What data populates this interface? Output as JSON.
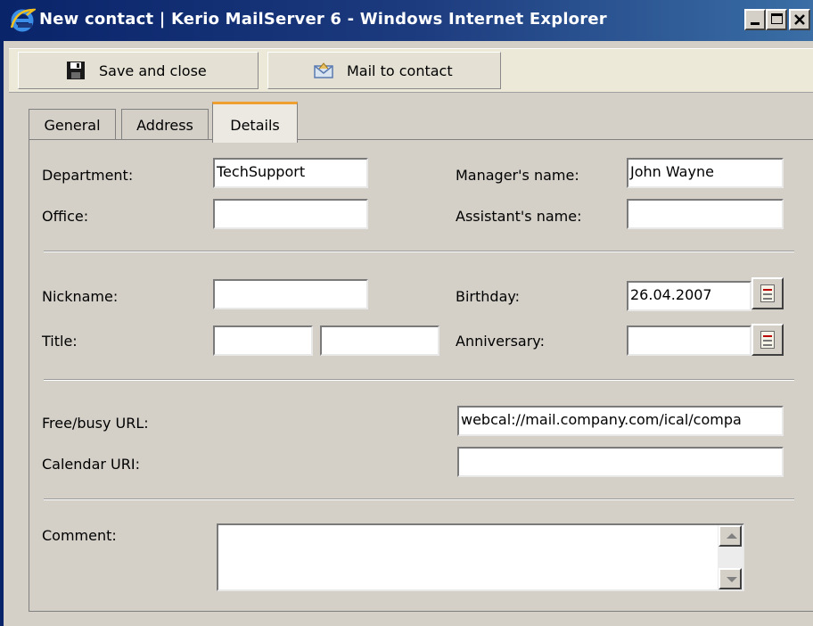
{
  "window": {
    "title": "New contact | Kerio MailServer 6 - Windows Internet Explorer",
    "icon": "internet-explorer-icon"
  },
  "toolbar": {
    "save_label": "Save and close",
    "save_icon": "floppy-disk-icon",
    "mail_label": "Mail to contact",
    "mail_icon": "envelope-icon"
  },
  "tabs": [
    {
      "label": "General"
    },
    {
      "label": "Address"
    },
    {
      "label": "Details",
      "active": true
    }
  ],
  "form": {
    "department_label": "Department:",
    "department_value": "TechSupport",
    "manager_label": "Manager's name:",
    "manager_value": "John Wayne",
    "office_label": "Office:",
    "office_value": "",
    "assistant_label": "Assistant's name:",
    "assistant_value": "",
    "nickname_label": "Nickname:",
    "nickname_value": "",
    "birthday_label": "Birthday:",
    "birthday_value": "26.04.2007",
    "title_label": "Title:",
    "title_value_1": "",
    "title_value_2": "",
    "anniversary_label": "Anniversary:",
    "anniversary_value": "",
    "freebusy_label": "Free/busy URL:",
    "freebusy_value": "webcal://mail.company.com/ical/compa",
    "calendar_label": "Calendar URI:",
    "calendar_value": "",
    "comment_label": "Comment:",
    "comment_value": ""
  },
  "colors": {
    "titlebar": "#0a246a",
    "active_tab_accent": "#f0a030",
    "panel_bg": "#d4d0c8"
  }
}
